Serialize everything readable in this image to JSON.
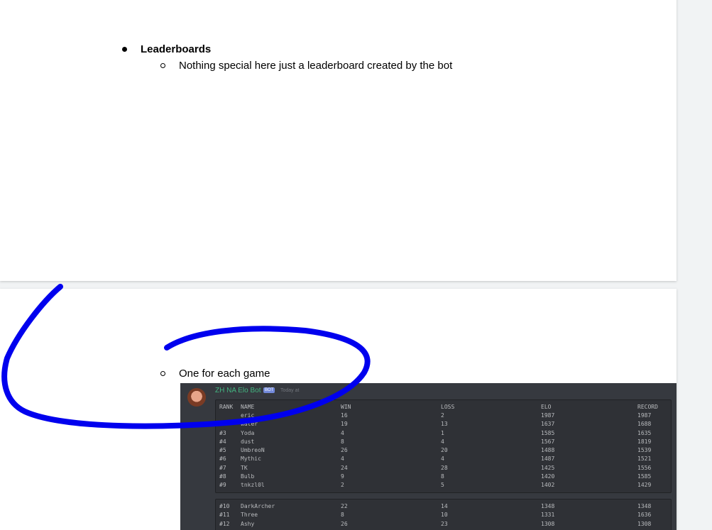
{
  "document": {
    "bullet": "Leaderboards",
    "sub_items": [
      "Nothing special here just a leaderboard created by the bot",
      "One for each game"
    ]
  },
  "discord_message": {
    "bot_name": "ZH NA Elo Bot",
    "badge": "BOT",
    "timestamp": "Today at",
    "colors": {
      "background": "#36393f",
      "codeblock": "#2f3136",
      "bot_name": "#43b581",
      "badge": "#7289da"
    },
    "headers": [
      "RANK",
      "NAME",
      "WIN",
      "LOSS",
      "ELO",
      "RECORD"
    ],
    "block1": [
      [
        "",
        "eric",
        "16",
        "2",
        "1987",
        "1987"
      ],
      [
        "#2",
        "water",
        "19",
        "13",
        "1637",
        "1688"
      ],
      [
        "#3",
        "Yoda",
        "4",
        "1",
        "1585",
        "1635"
      ],
      [
        "#4",
        "dust",
        "8",
        "4",
        "1567",
        "1819"
      ],
      [
        "#5",
        "UmbreoN",
        "26",
        "20",
        "1488",
        "1539"
      ],
      [
        "#6",
        "Mythic",
        "4",
        "4",
        "1487",
        "1521"
      ],
      [
        "#7",
        "TK",
        "24",
        "28",
        "1425",
        "1556"
      ],
      [
        "#8",
        "Bulb",
        "9",
        "8",
        "1420",
        "1585"
      ],
      [
        "#9",
        "tnkzl0l",
        "2",
        "5",
        "1402",
        "1429"
      ]
    ],
    "block2": [
      [
        "#10",
        "DarkArcher",
        "22",
        "14",
        "1348",
        "1348"
      ],
      [
        "#11",
        "Three",
        "8",
        "10",
        "1331",
        "1636"
      ],
      [
        "#12",
        "Ashy",
        "26",
        "23",
        "1308",
        "1308"
      ]
    ]
  },
  "annotation": {
    "stroke_color": "#0000ee"
  }
}
